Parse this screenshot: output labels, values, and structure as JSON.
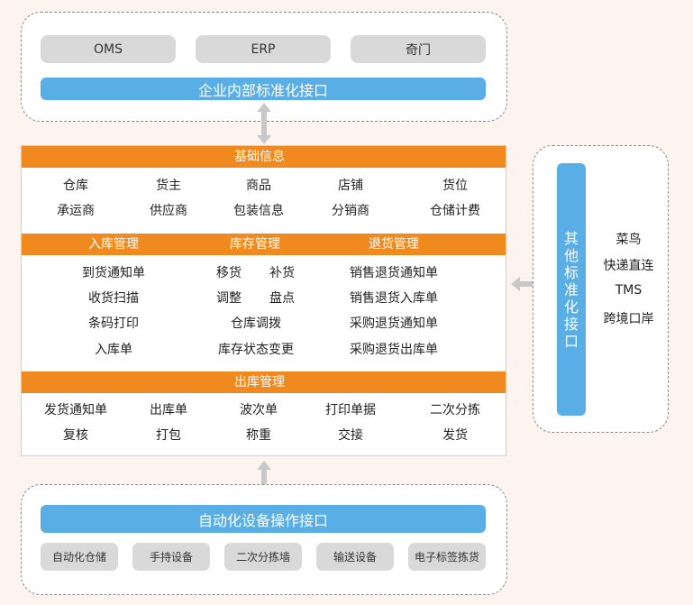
{
  "top": {
    "systems": [
      "OMS",
      "ERP",
      "奇门"
    ],
    "interface_label": "企业内部标准化接口"
  },
  "main": {
    "basic_info": {
      "header": "基础信息",
      "row1": [
        "仓库",
        "货主",
        "商品",
        "店铺",
        "货位"
      ],
      "row2": [
        "承运商",
        "供应商",
        "包装信息",
        "分销商",
        "仓储计费"
      ]
    },
    "management": {
      "headers": [
        "入库管理",
        "库存管理",
        "退货管理"
      ],
      "inbound": [
        "到货通知单",
        "收货扫描",
        "条码打印",
        "入库单"
      ],
      "inventory_pairs": [
        [
          "移货",
          "补货"
        ],
        [
          "调整",
          "盘点"
        ]
      ],
      "inventory_single": [
        "仓库调拨",
        "库存状态变更"
      ],
      "returns": [
        "销售退货通知单",
        "销售退货入库单",
        "采购退货通知单",
        "采购退货出库单"
      ]
    },
    "outbound": {
      "header": "出库管理",
      "row1": [
        "发货通知单",
        "出库单",
        "波次单",
        "打印单据",
        "二次分拣"
      ],
      "row2": [
        "复核",
        "打包",
        "称重",
        "交接",
        "发货"
      ]
    }
  },
  "side": {
    "interface_label": "其他标准化接口",
    "items": [
      "菜鸟",
      "快递直连",
      "TMS",
      "跨境口岸"
    ]
  },
  "bottom": {
    "interface_label": "自动化设备操作接口",
    "devices": [
      "自动化仓储",
      "手持设备",
      "二次分拣墙",
      "输送设备",
      "电子标签拣货"
    ]
  },
  "colors": {
    "orange": "#f08a1e",
    "blue": "#5aaee6",
    "gray": "#d9d9d9",
    "background": "#fdf4ef"
  }
}
